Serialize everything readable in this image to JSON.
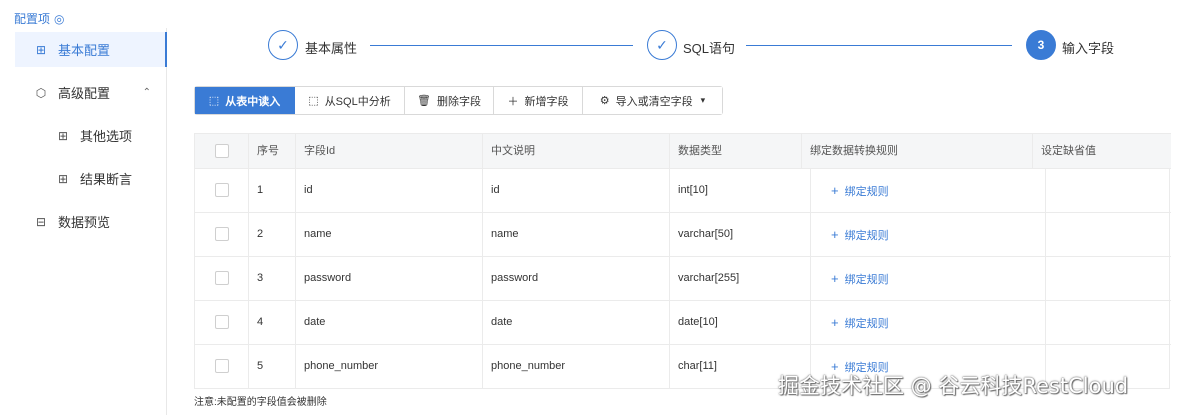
{
  "config_title": "配置项",
  "sidebar": {
    "items": [
      {
        "label": "基本配置",
        "icon": "grid-icon",
        "active": true
      },
      {
        "label": "高级配置",
        "icon": "cube-icon",
        "expanded": true
      },
      {
        "label": "其他选项",
        "icon": "grid-icon"
      },
      {
        "label": "结果断言",
        "icon": "grid-icon"
      },
      {
        "label": "数据预览",
        "icon": "preview-icon"
      }
    ]
  },
  "steps": [
    {
      "label": "基本属性",
      "status": "done",
      "mark": "✓"
    },
    {
      "label": "SQL语句",
      "status": "done",
      "mark": "✓"
    },
    {
      "label": "输入字段",
      "status": "current",
      "mark": "3"
    }
  ],
  "toolbar": {
    "read_from_table": "从表中读入",
    "analyze_sql": "从SQL中分析",
    "delete_field": "删除字段",
    "add_field": "新增字段",
    "import_clear": "导入或清空字段"
  },
  "table": {
    "headers": [
      "序号",
      "字段Id",
      "中文说明",
      "数据类型",
      "绑定数据转换规则",
      "设定缺省值"
    ],
    "rows": [
      {
        "no": "1",
        "field_id": "id",
        "desc": "id",
        "type": "int[10]",
        "rule": "绑定规则",
        "default": ""
      },
      {
        "no": "2",
        "field_id": "name",
        "desc": "name",
        "type": "varchar[50]",
        "rule": "绑定规则",
        "default": ""
      },
      {
        "no": "3",
        "field_id": "password",
        "desc": "password",
        "type": "varchar[255]",
        "rule": "绑定规则",
        "default": ""
      },
      {
        "no": "4",
        "field_id": "date",
        "desc": "date",
        "type": "date[10]",
        "rule": "绑定规则",
        "default": ""
      },
      {
        "no": "5",
        "field_id": "phone_number",
        "desc": "phone_number",
        "type": "char[11]",
        "rule": "绑定规则",
        "default": ""
      }
    ]
  },
  "note": "注意:未配置的字段值会被删除",
  "watermark": "掘金技术社区 @ 谷云科技RestCloud",
  "colors": {
    "accent": "#3a7bd5",
    "header_bg": "#f5f6f7",
    "border": "#ebebeb"
  }
}
